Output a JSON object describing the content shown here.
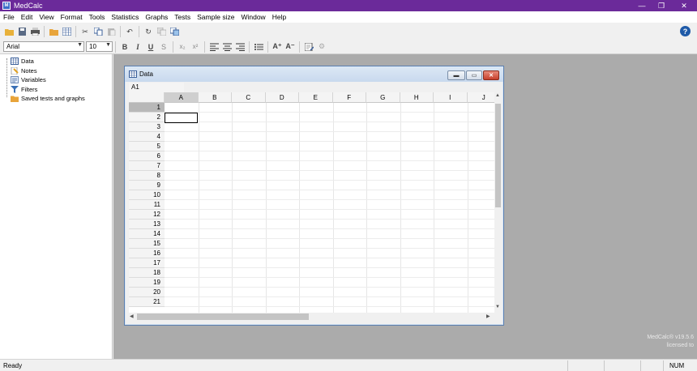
{
  "app": {
    "title": "MedCalc"
  },
  "menu": [
    "File",
    "Edit",
    "View",
    "Format",
    "Tools",
    "Statistics",
    "Graphs",
    "Tests",
    "Sample size",
    "Window",
    "Help"
  ],
  "format_bar": {
    "font": "Arial",
    "size": "10",
    "bold": "B",
    "italic": "I",
    "underline": "U",
    "strike": "S",
    "subscript": "x₂",
    "superscript": "x²",
    "grow": "A⁺",
    "shrink": "A⁻"
  },
  "help": "?",
  "sidebar": {
    "items": [
      {
        "label": "Data",
        "icon": "grid-icon"
      },
      {
        "label": "Notes",
        "icon": "notes-icon"
      },
      {
        "label": "Variables",
        "icon": "variables-icon"
      },
      {
        "label": "Filters",
        "icon": "filter-icon"
      },
      {
        "label": "Saved tests and graphs",
        "icon": "folder-icon"
      }
    ]
  },
  "data_window": {
    "title": "Data",
    "cell_ref": "A1",
    "columns": [
      "A",
      "B",
      "C",
      "D",
      "E",
      "F",
      "G",
      "H",
      "I",
      "J"
    ],
    "rows": [
      "1",
      "2",
      "3",
      "4",
      "5",
      "6",
      "7",
      "8",
      "9",
      "10",
      "11",
      "12",
      "13",
      "14",
      "15",
      "16",
      "17",
      "18",
      "19",
      "20",
      "21"
    ],
    "selected_column": "A",
    "selected_row": "1"
  },
  "version": {
    "line1": "MedCalc® v19.5.6",
    "line2": "licensed to"
  },
  "status": {
    "ready": "Ready",
    "num": "NUM"
  },
  "colors": {
    "titlebar": "#6b2a9a",
    "workspace": "#ababab"
  }
}
